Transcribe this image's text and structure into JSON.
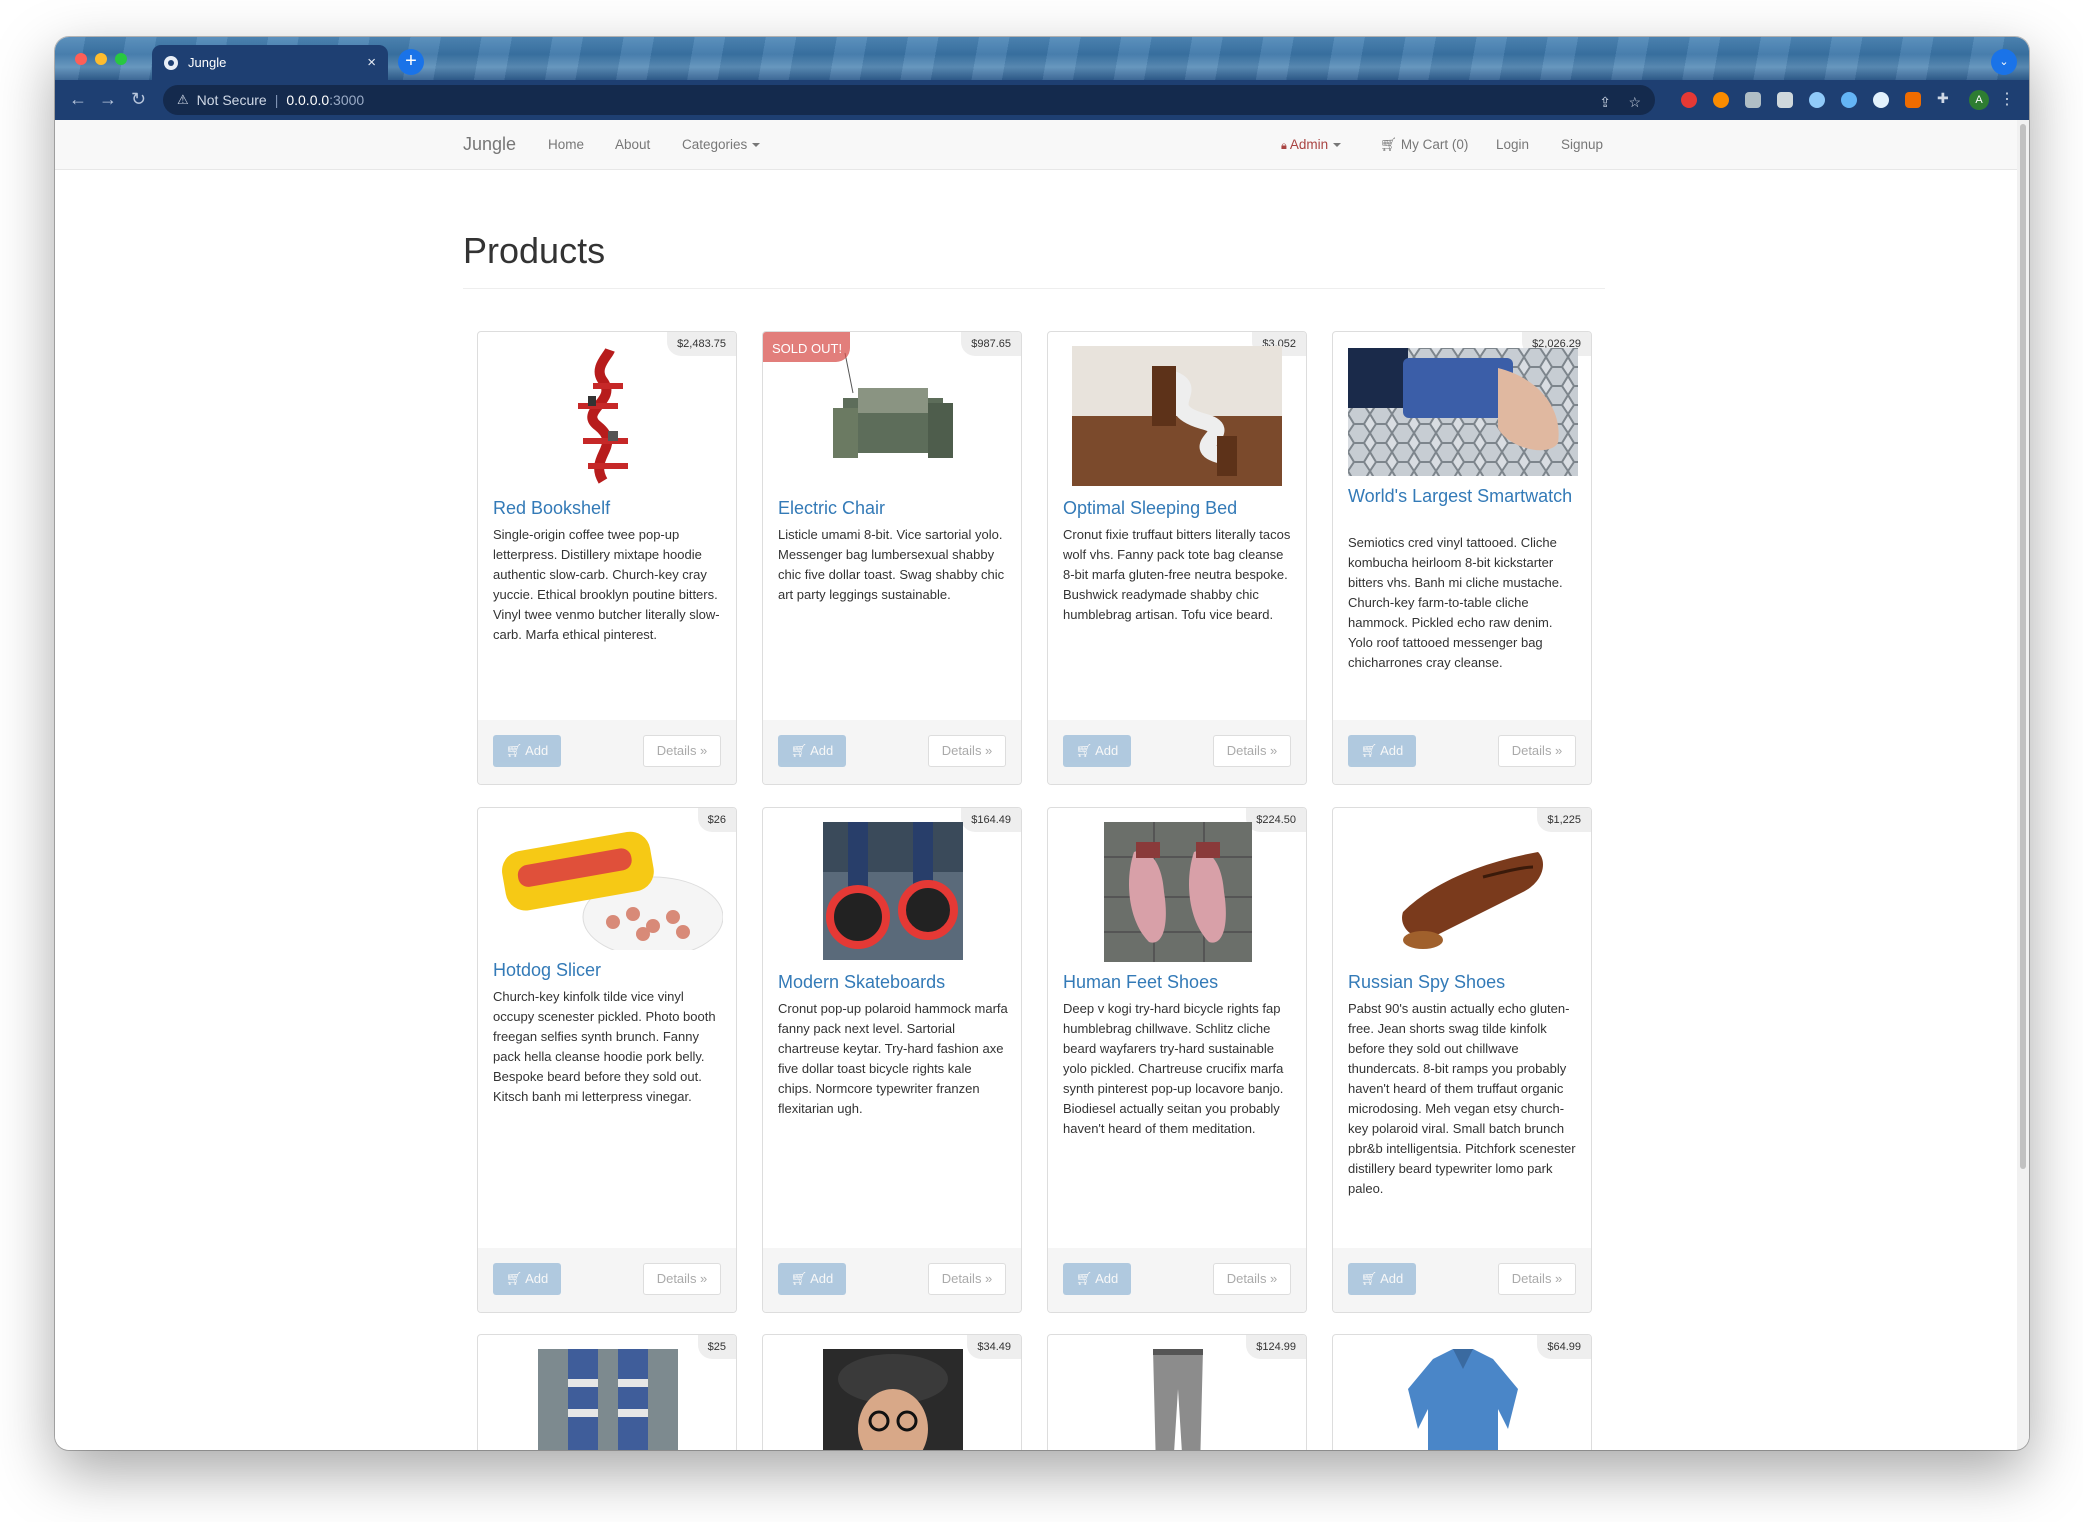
{
  "browser": {
    "tab_title": "Jungle",
    "tab_close": "×",
    "new_tab": "+",
    "address_warning": "Not Secure",
    "address_host": "0.0.0.0",
    "address_port": ":3000",
    "profile_initial": "A"
  },
  "navbar": {
    "brand": "Jungle",
    "home": "Home",
    "about": "About",
    "categories": "Categories",
    "admin": "Admin",
    "cart": "My Cart (0)",
    "login": "Login",
    "signup": "Signup"
  },
  "page": {
    "title": "Products"
  },
  "products": [
    {
      "name": "Red Bookshelf",
      "price": "$2,483.75",
      "sold_out": false,
      "description": "Single-origin coffee twee pop-up letterpress. Distillery mixtape hoodie authentic slow-carb. Church-key cray yuccie. Ethical brooklyn poutine bitters. Vinyl twee venmo butcher literally slow-carb. Marfa ethical pinterest."
    },
    {
      "name": "Electric Chair",
      "price": "$987.65",
      "sold_out": true,
      "sold_out_label": "SOLD OUT!",
      "description": "Listicle umami 8-bit. Vice sartorial yolo. Messenger bag lumbersexual shabby chic five dollar toast. Swag shabby chic art party leggings sustainable."
    },
    {
      "name": "Optimal Sleeping Bed",
      "price": "$3,052",
      "sold_out": false,
      "description": "Cronut fixie truffaut bitters literally tacos wolf vhs. Fanny pack tote bag cleanse 8-bit marfa gluten-free neutra bespoke. Bushwick readymade shabby chic humblebrag artisan. Tofu vice beard."
    },
    {
      "name": "World's Largest Smartwatch",
      "price": "$2,026.29",
      "sold_out": false,
      "description": "Semiotics cred vinyl tattooed. Cliche kombucha heirloom 8-bit kickstarter bitters vhs. Banh mi cliche mustache. Church-key farm-to-table cliche hammock. Pickled echo raw denim. Yolo roof tattooed messenger bag chicharrones cray cleanse."
    },
    {
      "name": "Hotdog Slicer",
      "price": "$26",
      "sold_out": false,
      "description": "Church-key kinfolk tilde vice vinyl occupy scenester pickled. Photo booth freegan selfies synth brunch. Fanny pack hella cleanse hoodie pork belly. Bespoke beard before they sold out. Kitsch banh mi letterpress vinegar."
    },
    {
      "name": "Modern Skateboards",
      "price": "$164.49",
      "sold_out": false,
      "description": "Cronut pop-up polaroid hammock marfa fanny pack next level. Sartorial chartreuse keytar. Try-hard fashion axe five dollar toast bicycle rights kale chips. Normcore typewriter franzen flexitarian ugh."
    },
    {
      "name": "Human Feet Shoes",
      "price": "$224.50",
      "sold_out": false,
      "description": "Deep v kogi try-hard bicycle rights fap humblebrag chillwave. Schlitz cliche beard wayfarers try-hard sustainable yolo pickled. Chartreuse crucifix marfa synth pinterest pop-up locavore banjo. Biodiesel actually seitan you probably haven't heard of them meditation."
    },
    {
      "name": "Russian Spy Shoes",
      "price": "$1,225",
      "sold_out": false,
      "description": "Pabst 90's austin actually echo gluten-free. Jean shorts swag tilde kinfolk before they sold out chillwave thundercats. 8-bit ramps you probably haven't heard of them truffaut organic microdosing. Meh vegan etsy church-key polaroid viral. Small batch brunch pbr&b intelligentsia. Pitchfork scenester distillery beard typewriter lomo park paleo."
    },
    {
      "name": "",
      "price": "$25",
      "sold_out": false,
      "description": ""
    },
    {
      "name": "",
      "price": "$34.49",
      "sold_out": false,
      "description": ""
    },
    {
      "name": "",
      "price": "$124.99",
      "sold_out": false,
      "description": ""
    },
    {
      "name": "",
      "price": "$64.99",
      "sold_out": false,
      "description": ""
    }
  ],
  "buttons": {
    "add": "Add",
    "details": "Details »"
  },
  "icons": {
    "cart": "shopping-cart-icon",
    "lock": "lock-icon",
    "back": "back-arrow-icon",
    "forward": "forward-arrow-icon",
    "reload": "reload-icon",
    "warning": "warning-icon",
    "share": "share-icon",
    "star": "bookmark-star-icon",
    "extensions": "puzzle-icon",
    "menu": "kebab-menu-icon"
  },
  "colors": {
    "link": "#337ab7",
    "admin": "#a94442",
    "sold_out": "#d9534f",
    "chrome_toolbar": "#1e3f72"
  }
}
